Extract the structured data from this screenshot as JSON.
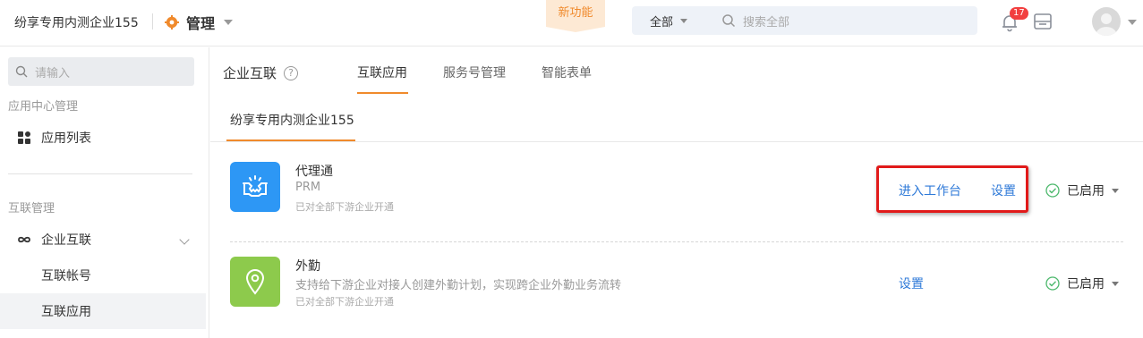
{
  "topbar": {
    "company": "纷享专用内测企业155",
    "manage_label": "管理",
    "new_feature": "新功能",
    "search_scope": "全部",
    "search_placeholder": "搜索全部",
    "notification_count": "17"
  },
  "sidebar": {
    "search_placeholder": "请输入",
    "group1": "应用中心管理",
    "app_list": "应用列表",
    "group2": "互联管理",
    "enterprise_link": "企业互联",
    "sub_account": "互联帐号",
    "sub_apps": "互联应用"
  },
  "main": {
    "title": "企业互联",
    "help": "?",
    "tabs": [
      "互联应用",
      "服务号管理",
      "智能表单"
    ],
    "subtab": "纷享专用内测企业155",
    "apps": [
      {
        "name": "代理通",
        "desc": "PRM",
        "note": "已对全部下游企业开通",
        "action1": "进入工作台",
        "action2": "设置",
        "status": "已启用",
        "icon": "handshake-icon",
        "color": "#2d97f5"
      },
      {
        "name": "外勤",
        "desc": "支持给下游企业对接人创建外勤计划，实现跨企业外勤业务流转",
        "note": "已对全部下游企业开通",
        "action2": "设置",
        "status": "已启用",
        "icon": "location-pin-icon",
        "color": "#8dca4c"
      }
    ]
  },
  "colors": {
    "accent": "#f08a2c",
    "link": "#2f7ad8",
    "highlight": "#e11a1a"
  }
}
